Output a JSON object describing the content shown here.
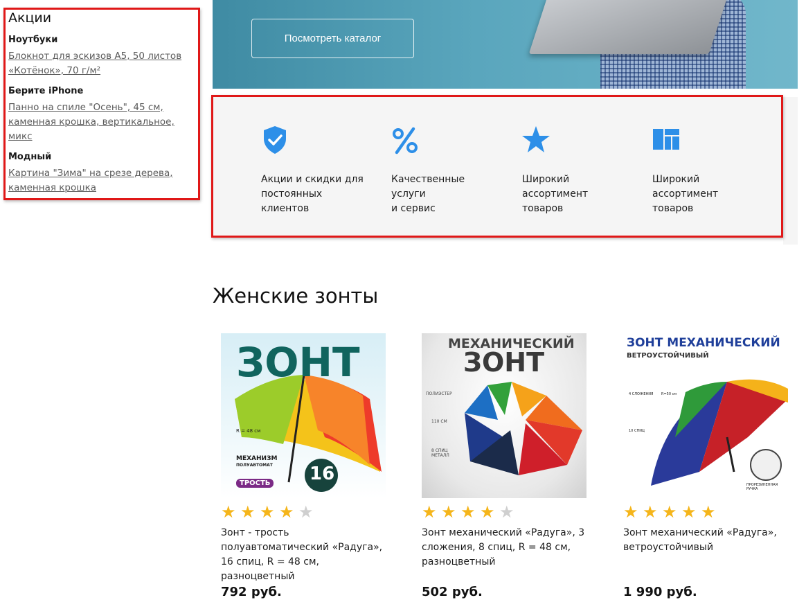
{
  "sidebar": {
    "title": "Акции",
    "groups": [
      {
        "title": "Ноутбуки",
        "link": "Блокнот для эскизов А5, 50 листов «Котёнок», 70 г/м²"
      },
      {
        "title": "Берите iPhone",
        "link": "Панно на спиле \"Осень\", 45 см, каменная крошка, вертикальное, микс"
      },
      {
        "title": "Модный",
        "link": "Картина \"Зима\" на срезе дерева, каменная крошка"
      }
    ]
  },
  "hero": {
    "button_label": "Посмотреть каталог"
  },
  "advantages": [
    {
      "icon": "shield-check-icon",
      "text": "Акции и скидки для\nпостоянных\nклиентов"
    },
    {
      "icon": "percent-icon",
      "text": "Качественные\nуслуги\nи сервис"
    },
    {
      "icon": "star-icon",
      "text": "Широкий\nассортимент\nтоваров"
    },
    {
      "icon": "layout-grid-icon",
      "text": "Широкий\nассортимент\nтоваров"
    }
  ],
  "section": {
    "title": "Женские зонты"
  },
  "products": [
    {
      "name": "Зонт - трость полуавтоматический «Радуга», 16 спиц, R = 48 см, разноцветный",
      "price": "792 руб.",
      "rating": 4,
      "image_text": {
        "headline": "ЗОНТ",
        "r_label": "R = 48 см",
        "mechanism": "МЕХАНИЗМ",
        "mechanism_sub": "ПОЛУАВТОМАТ",
        "tag": "ТРОСТЬ",
        "spokes": "16"
      }
    },
    {
      "name": "Зонт механический «Радуга», 3 сложения, 8 спиц, R = 48 см, разноцветный",
      "price": "502 руб.",
      "rating": 4,
      "image_text": {
        "headline_top": "МЕХАНИЧЕСКИЙ",
        "headline": "ЗОНТ",
        "f1": "ПОЛИЭСТЕР",
        "f2": "110 СМ",
        "f3": "8 СПИЦ МЕТАЛЛ"
      }
    },
    {
      "name": "Зонт механический «Радуга», ветроустойчивый",
      "price": "1 990 руб.",
      "rating": 5,
      "image_text": {
        "headline": "ЗОНТ МЕХАНИЧЕСКИЙ",
        "sub": "ВЕТРОУСТОЙЧИВЫЙ",
        "f1": "4 СЛОЖЕНИЯ",
        "f2": "R=50 см",
        "f3": "10 СПИЦ",
        "f4": "ПРОРЕЗИНЕННАЯ РУЧКА"
      }
    }
  ],
  "colors": {
    "highlight_border": "#e01818",
    "accent_blue": "#2d8fe8",
    "star_on": "#f5b51a",
    "star_off": "#cfcfcf"
  }
}
